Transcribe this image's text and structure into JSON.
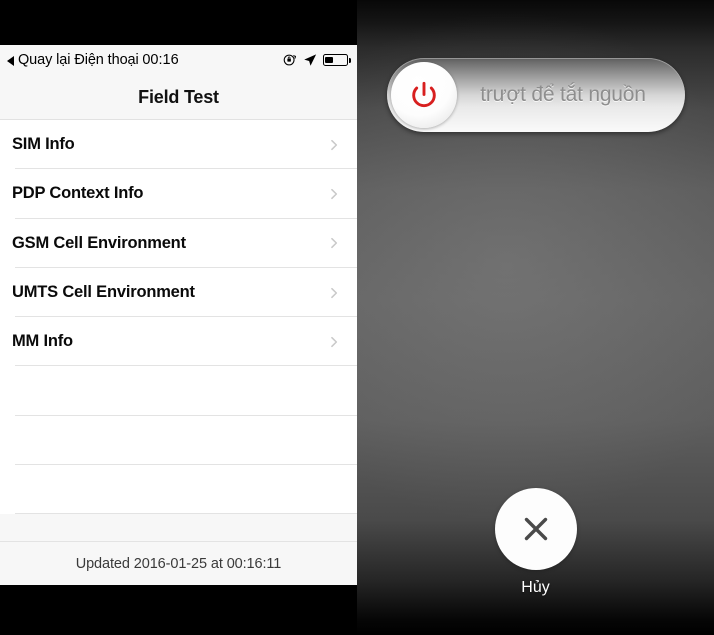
{
  "left": {
    "status_bar": {
      "back_label": "Quay lại Điện thoại",
      "clock": "00:16",
      "icons": [
        "rotation-lock-icon",
        "location-arrow-icon",
        "battery-icon"
      ],
      "battery_percent": 36
    },
    "nav": {
      "title": "Field Test"
    },
    "table": {
      "rows": [
        {
          "label": "SIM Info",
          "accessory": "chevron-right-icon"
        },
        {
          "label": "PDP Context Info",
          "accessory": "chevron-right-icon"
        },
        {
          "label": "GSM Cell Environment",
          "accessory": "chevron-right-icon"
        },
        {
          "label": "UMTS Cell Environment",
          "accessory": "chevron-right-icon"
        },
        {
          "label": "MM Info",
          "accessory": "chevron-right-icon"
        }
      ],
      "empty_rows": 3
    },
    "footer": {
      "text": "Updated 2016-01-25 at 00:16:11"
    }
  },
  "right": {
    "slider": {
      "label": "trượt để tắt nguồn",
      "knob_icon": "power-icon",
      "knob_icon_color": "#d81f1f"
    },
    "cancel": {
      "icon": "close-x-icon",
      "label": "Hủy"
    }
  },
  "colors": {
    "accent_red": "#d81f1f",
    "list_background": "#ffffff",
    "chrome_background": "#f7f7f7",
    "separator": "#e3e3e3",
    "bezel": "#000000"
  }
}
